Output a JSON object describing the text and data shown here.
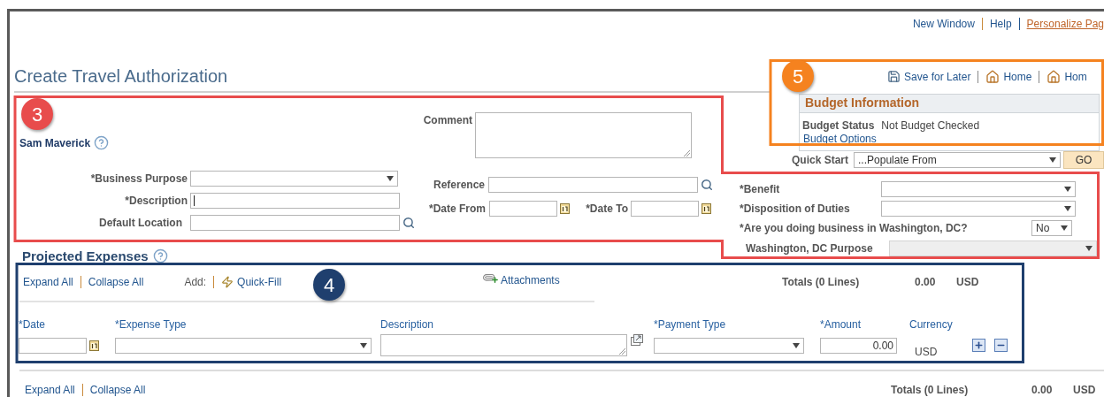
{
  "top_links": [
    {
      "label": "New Window",
      "kind": "plain"
    },
    {
      "label": "Help",
      "kind": "plain"
    },
    {
      "label": "Personalize Pag",
      "kind": "accent"
    }
  ],
  "page_title": "Create Travel Authorization",
  "header_actions": [
    {
      "label": "Save for Later",
      "kind": "save"
    },
    {
      "label": "Home",
      "kind": "home"
    },
    {
      "label": "Hom",
      "kind": "home"
    }
  ],
  "budget": {
    "title": "Budget Information",
    "status_label": "Budget Status",
    "status_value": "Not Budget Checked",
    "options_link": "Budget Options"
  },
  "quick_start": {
    "label": "Quick Start",
    "value": "...Populate From",
    "button": "GO"
  },
  "employee": "Sam Maverick",
  "general_fields": [
    {
      "label": "*Business Purpose",
      "kind": "select"
    },
    {
      "label": "*Description",
      "kind": "text"
    },
    {
      "label": "Default Location",
      "kind": "lookup"
    }
  ],
  "comment": {
    "label": "Comment"
  },
  "reference": {
    "label": "Reference"
  },
  "dates": [
    {
      "label": "*Date From"
    },
    {
      "label": "*Date To"
    }
  ],
  "extra_fields": [
    {
      "label": "*Benefit",
      "kind": "select",
      "disabled": false
    },
    {
      "label": "*Disposition of Duties",
      "kind": "select",
      "disabled": false
    },
    {
      "label": "*Are you doing business in Washington, DC?",
      "kind": "yesno",
      "value": "No",
      "disabled": false
    },
    {
      "label": "Washington, DC Purpose",
      "kind": "select",
      "disabled": true
    }
  ],
  "projected_expenses": {
    "title": "Projected Expenses",
    "expand": "Expand All",
    "collapse": "Collapse All",
    "add_label": "Add:",
    "quick_fill": "Quick-Fill",
    "attachments": "Attachments",
    "totals": {
      "label": "Totals (0 Lines)",
      "amount": "0.00",
      "currency": "USD"
    },
    "columns": [
      "*Date",
      "*Expense Type",
      "Description",
      "*Payment Type",
      "*Amount",
      "Currency"
    ],
    "row": {
      "amount": "0.00",
      "currency": "USD"
    }
  },
  "footer": {
    "expand": "Expand All",
    "collapse": "Collapse All",
    "totals_label": "Totals (0 Lines)",
    "amount": "0.00",
    "currency": "USD"
  },
  "callouts": [
    {
      "number": "3",
      "color": "#e84c4c"
    },
    {
      "number": "5",
      "color": "#f5821f"
    },
    {
      "number": "4",
      "color": "#1f3f6e"
    }
  ]
}
